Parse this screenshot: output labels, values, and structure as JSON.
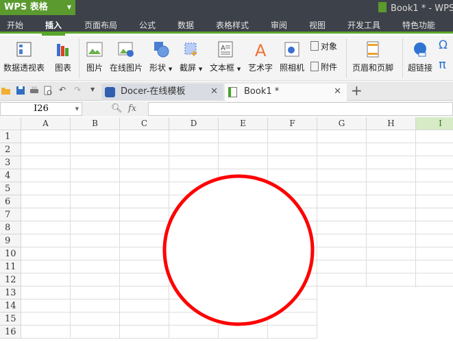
{
  "app": {
    "logo": "WPS 表格",
    "window_title": "Book1 * - WPS"
  },
  "menu": [
    "开始",
    "插入",
    "页面布局",
    "公式",
    "数据",
    "表格样式",
    "审阅",
    "视图",
    "开发工具",
    "特色功能"
  ],
  "menu_active": 1,
  "ribbon": {
    "pivot": "数据透视表",
    "chart": "图表",
    "picture": "图片",
    "online_picture": "在线图片",
    "shape": "形状",
    "screenshot": "截屏",
    "textbox": "文本框",
    "wordart": "艺术字",
    "camera": "照相机",
    "object": "对象",
    "attachment": "附件",
    "header_footer": "页眉和页脚",
    "hyperlink": "超链接"
  },
  "tabs": [
    {
      "label": "Docer-在线模板"
    },
    {
      "label": "Book1 *"
    }
  ],
  "formula": {
    "name_box": "I26",
    "fx": "fx",
    "value": ""
  },
  "columns": [
    "A",
    "B",
    "C",
    "D",
    "E",
    "F",
    "G",
    "H",
    "I"
  ],
  "rows": [
    "1",
    "2",
    "3",
    "4",
    "5",
    "6",
    "7",
    "8",
    "9",
    "10",
    "11",
    "12",
    "13",
    "14",
    "15",
    "16"
  ],
  "selected_column": "I",
  "shape": {
    "type": "circle",
    "stroke": "#ff0000"
  }
}
